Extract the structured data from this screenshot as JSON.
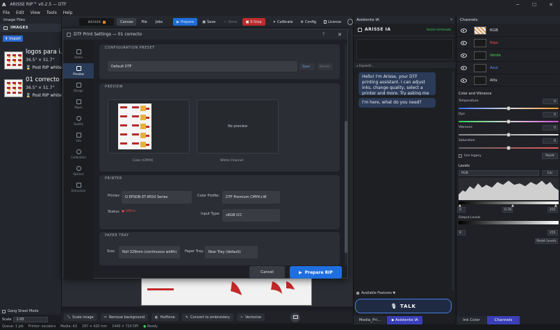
{
  "app": {
    "title": "ARISSE RIP™ v0.2.5 — DTF",
    "menu": [
      "File",
      "Edit",
      "View",
      "Tools",
      "Help"
    ],
    "colors": {
      "accent": "#2f6bd0",
      "stop": "#c22d2d",
      "prepare": "#1f6fe0",
      "offline": "#e04a4a"
    }
  },
  "left": {
    "header": "Image Files",
    "section": "IMAGES",
    "import_label": "Import",
    "items": [
      {
        "name": "logos para i...",
        "size": "36.5\" × 51.7\"",
        "rip": "Post RIP white"
      },
      {
        "name": "01 correcto",
        "size": "36.5\" × 51.7\"",
        "rip": "Post RIP white"
      }
    ],
    "gang_label": "Gang Sheet Mode",
    "scale_label": "Scale",
    "scale_value": "1.00"
  },
  "toolbar": {
    "tabs": [
      "Canvas",
      "File",
      "Jobs"
    ],
    "prepare": "Prepare",
    "save": "Save",
    "done": "Done",
    "estop": "E-Stop",
    "calibrate": "Calibrate",
    "config": "Config",
    "license": "License"
  },
  "bottom": {
    "buttons": [
      "Scale image",
      "Remove background",
      "Halftone",
      "Convert to embroidery",
      "Vectorize"
    ]
  },
  "status": {
    "queue": "Queue: 1 job",
    "printer": "Printer: escalera",
    "media": "Media: A3",
    "dims": "297 × 420 mm",
    "dpi": "1440 × 720 DPI",
    "ready": "Ready"
  },
  "dialog": {
    "title": "DTF Print Settings — 01 correcto",
    "help": "?",
    "nav": [
      "Home",
      "Preview",
      "Design",
      "Paper",
      "Quality",
      "Info",
      "Calibration",
      "Options",
      "Extraction"
    ],
    "preset": {
      "header": "CONFIGURATION PRESET",
      "value": "Default DTF",
      "save": "Save",
      "delete": "Delete"
    },
    "preview": {
      "header": "PREVIEW",
      "color_caption": "Color (CMYK)",
      "no_preview": "No preview",
      "white_caption": "White Channel"
    },
    "printer": {
      "header": "PRINTER",
      "printer_label": "Printer:",
      "printer_value": "O EPSON ET-8550 Series",
      "status_label": "Status:",
      "status_value": "Offline",
      "profile_label": "Color Profile:",
      "profile_value": "DTF Premium CMYK+W",
      "input_label": "Input Type:",
      "input_value": "sRGB ICC"
    },
    "paper": {
      "header": "PAPER TRAY",
      "size_label": "Size:",
      "size_value": "Roll 329mm (continuous width)",
      "tray_label": "Paper Tray:",
      "tray_value": "Rear Tray (default)"
    },
    "cancel": "Cancel",
    "prepare": "Prepare RIP"
  },
  "assistant": {
    "panel_title": "Asistente IA",
    "brand": "ARISSE IA",
    "session": "Sesión terminada",
    "expand": "Expandir...",
    "msg_ai": "Hello! I'm Arisse, your DTF printing assistant. I can adjust inks, change quality, select a printer and more. Try asking me anything!",
    "msg_user": "I'm here, what do you need?",
    "features": "Available Features ▼",
    "talk": "TALK",
    "tabs": [
      "Media_Pri...",
      "Asistente IA"
    ]
  },
  "channels": {
    "title": "Channels",
    "rows": [
      {
        "name": "RGB",
        "color": "#dcdcdc"
      },
      {
        "name": "Rojo",
        "color": "#ff4b4b"
      },
      {
        "name": "Verde",
        "color": "#4bd24b"
      },
      {
        "name": "Azul",
        "color": "#5c8cff"
      },
      {
        "name": "Alfa",
        "color": "#dcdcdc"
      }
    ],
    "cv_header": "Color and Vibrance",
    "sliders": [
      {
        "label": "Temperature",
        "value": "0",
        "pos": 0.5
      },
      {
        "label": "Dye",
        "value": "0",
        "pos": 0.5
      },
      {
        "label": "Vibrance",
        "value": "0",
        "pos": 0.5
      },
      {
        "label": "Saturation",
        "value": "0",
        "pos": 0.5
      }
    ],
    "legacy": "Use legacy",
    "reset": "Reset",
    "levels_header": "Levels",
    "levels_channel": "RGB",
    "levels_btn": "Car",
    "levels_values": [
      "0",
      "0.78",
      "255"
    ],
    "output_header": "Output Levels",
    "output_values": [
      "0",
      "255"
    ],
    "reset_levels": "Reset Levels",
    "tabs": [
      "Ink Color",
      "Channels"
    ]
  }
}
